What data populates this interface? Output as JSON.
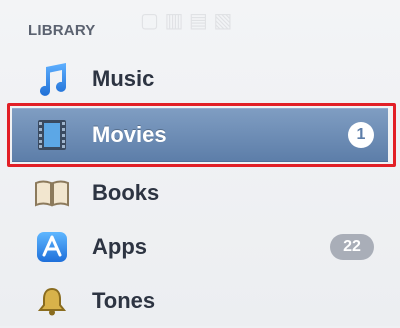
{
  "sidebar": {
    "section_title": "LIBRARY",
    "items": [
      {
        "label": "Music",
        "icon": "music-note-icon",
        "badge": ""
      },
      {
        "label": "Movies",
        "icon": "film-icon",
        "badge": "1",
        "selected": true
      },
      {
        "label": "Books",
        "icon": "book-icon",
        "badge": ""
      },
      {
        "label": "Apps",
        "icon": "app-store-icon",
        "badge": "22"
      },
      {
        "label": "Tones",
        "icon": "bell-icon",
        "badge": ""
      }
    ]
  },
  "colors": {
    "selection": "#6d8db6",
    "highlight_border": "#e21f26",
    "accent_blue": "#2f7de1"
  }
}
